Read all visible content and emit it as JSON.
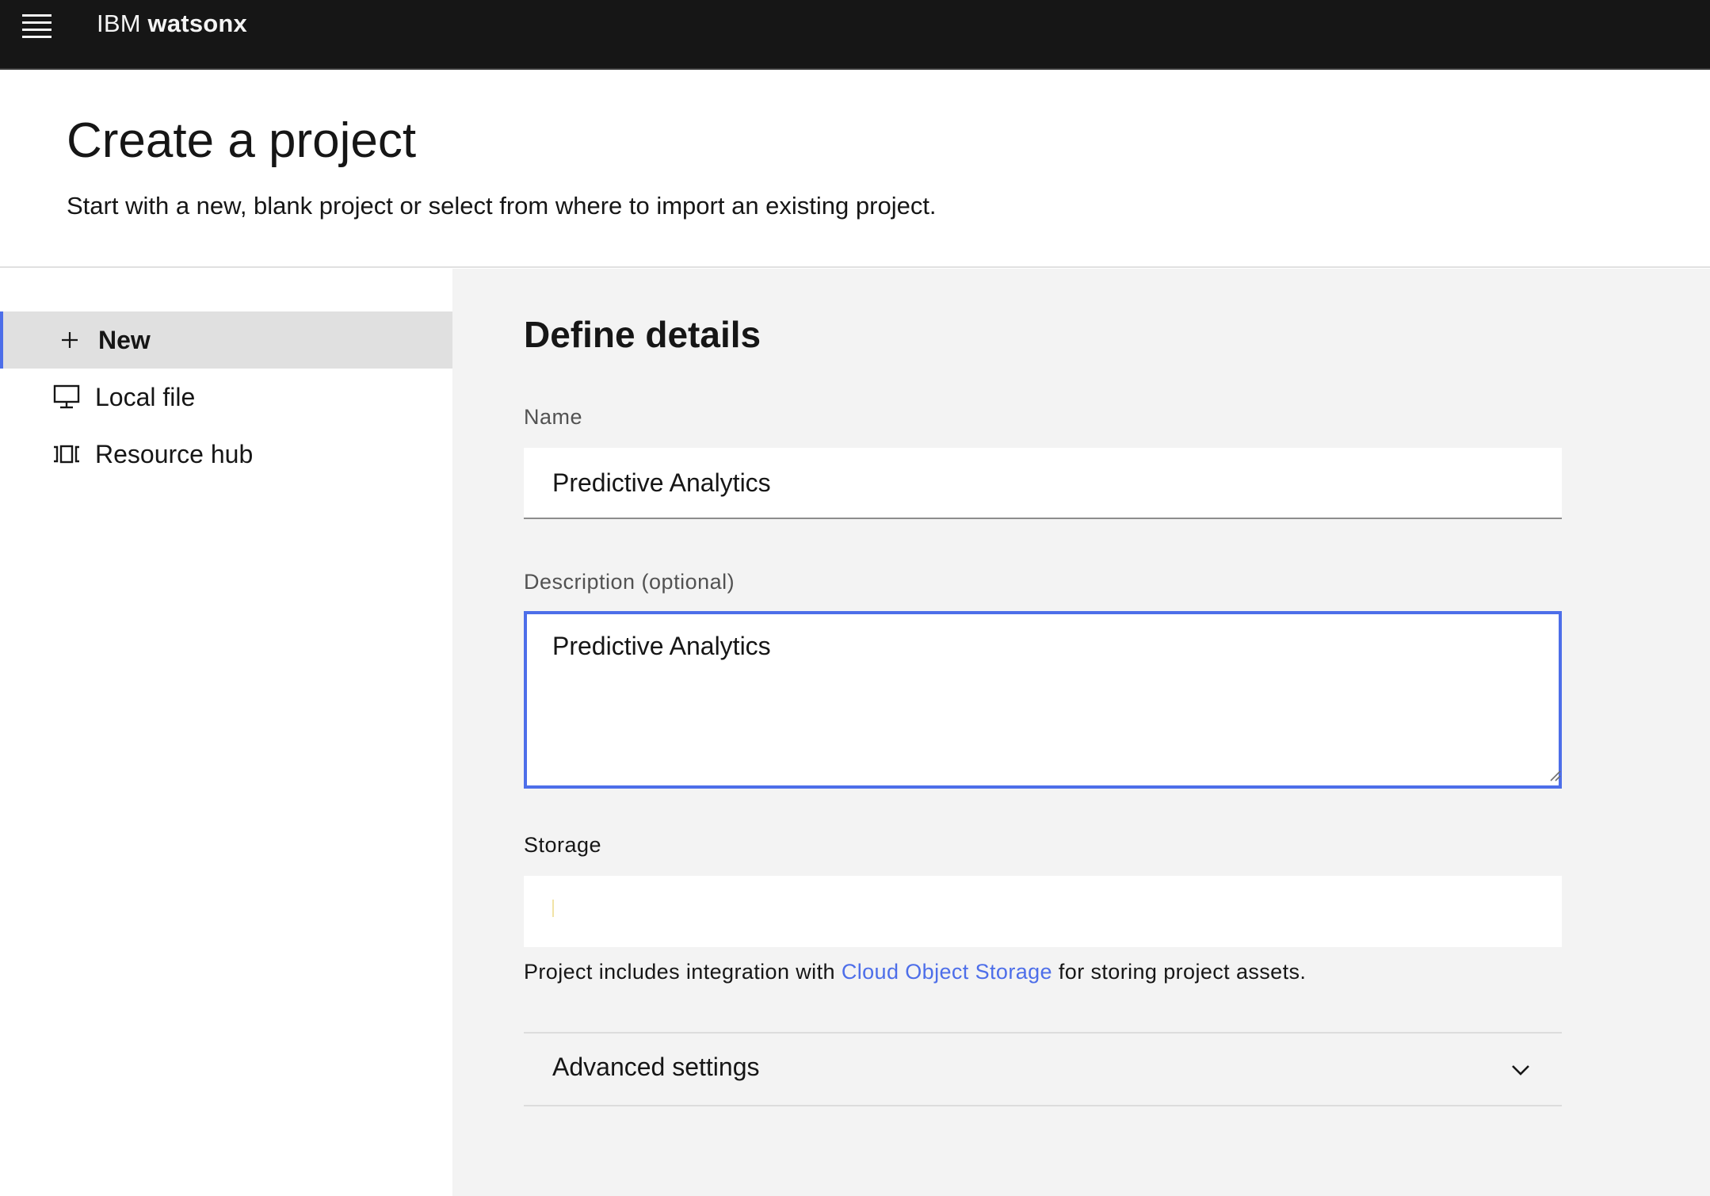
{
  "header": {
    "menu_icon": "hamburger-menu-icon",
    "brand_prefix": "IBM",
    "brand_product": "watsonx"
  },
  "page": {
    "title": "Create a project",
    "subtitle": "Start with a new, blank project or select from where to import an existing project."
  },
  "sidebar": {
    "items": [
      {
        "label": "New",
        "icon": "plus-icon",
        "active": true
      },
      {
        "label": "Local file",
        "icon": "monitor-icon",
        "active": false
      },
      {
        "label": "Resource hub",
        "icon": "carousel-icon",
        "active": false
      }
    ]
  },
  "main": {
    "section_title": "Define details",
    "name_label": "Name",
    "name_value": "Predictive Analytics",
    "description_label": "Description (optional)",
    "description_value": "Predictive Analytics",
    "storage_label": "Storage",
    "storage_value": "",
    "helper_prefix": "Project includes integration with ",
    "helper_link": "Cloud Object Storage",
    "helper_suffix": " for storing project assets.",
    "advanced_label": "Advanced settings"
  },
  "colors": {
    "accent": "#4d6ee9",
    "topbar": "#161616",
    "panel": "#f3f3f3",
    "active_nav": "#e0e0e0"
  }
}
